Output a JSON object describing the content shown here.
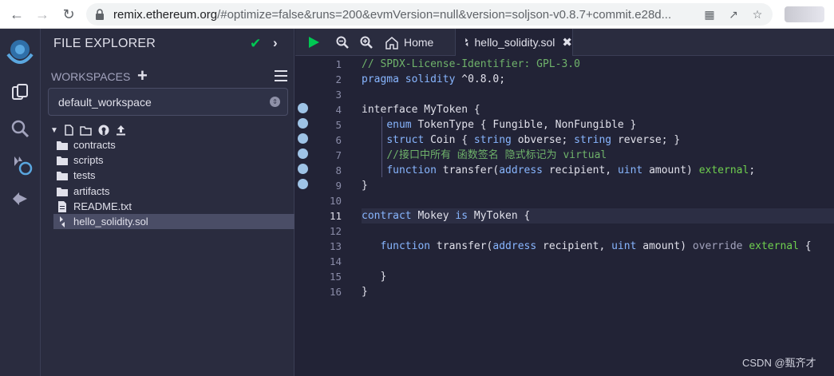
{
  "browser": {
    "url_host": "remix.ethereum.org",
    "url_rest": "/#optimize=false&runs=200&evmVersion=null&version=soljson-v0.8.7+commit.e28d..."
  },
  "file_explorer": {
    "title": "FILE EXPLORER",
    "workspaces_label": "WORKSPACES",
    "workspace_selected": "default_workspace",
    "tree": [
      {
        "name": "contracts",
        "type": "folder"
      },
      {
        "name": "scripts",
        "type": "folder"
      },
      {
        "name": "tests",
        "type": "folder"
      },
      {
        "name": "artifacts",
        "type": "folder"
      },
      {
        "name": "README.txt",
        "type": "file"
      },
      {
        "name": "hello_solidity.sol",
        "type": "solidity",
        "selected": true
      }
    ]
  },
  "editor": {
    "home_tab": "Home",
    "file_tab": "hello_solidity.sol",
    "active_line": 11,
    "lines": [
      "// SPDX-License-Identifier: GPL-3.0",
      "pragma solidity ^0.8.0;",
      "",
      "interface MyToken {",
      "    enum TokenType { Fungible, NonFungible }",
      "    struct Coin { string obverse; string reverse; }",
      "    //接口中所有 函数签名 隐式标记为 virtual",
      "    function transfer(address recipient, uint amount) external;",
      "}",
      "",
      "contract Mokey is MyToken {",
      "",
      "   function transfer(address recipient, uint amount) override external {",
      "",
      "   }",
      "}"
    ]
  },
  "watermark": "CSDN @甄齐才",
  "colors": {
    "accent_green": "#00c853",
    "keyword_blue": "#88b6ff",
    "comment_green": "#6fb26a"
  }
}
